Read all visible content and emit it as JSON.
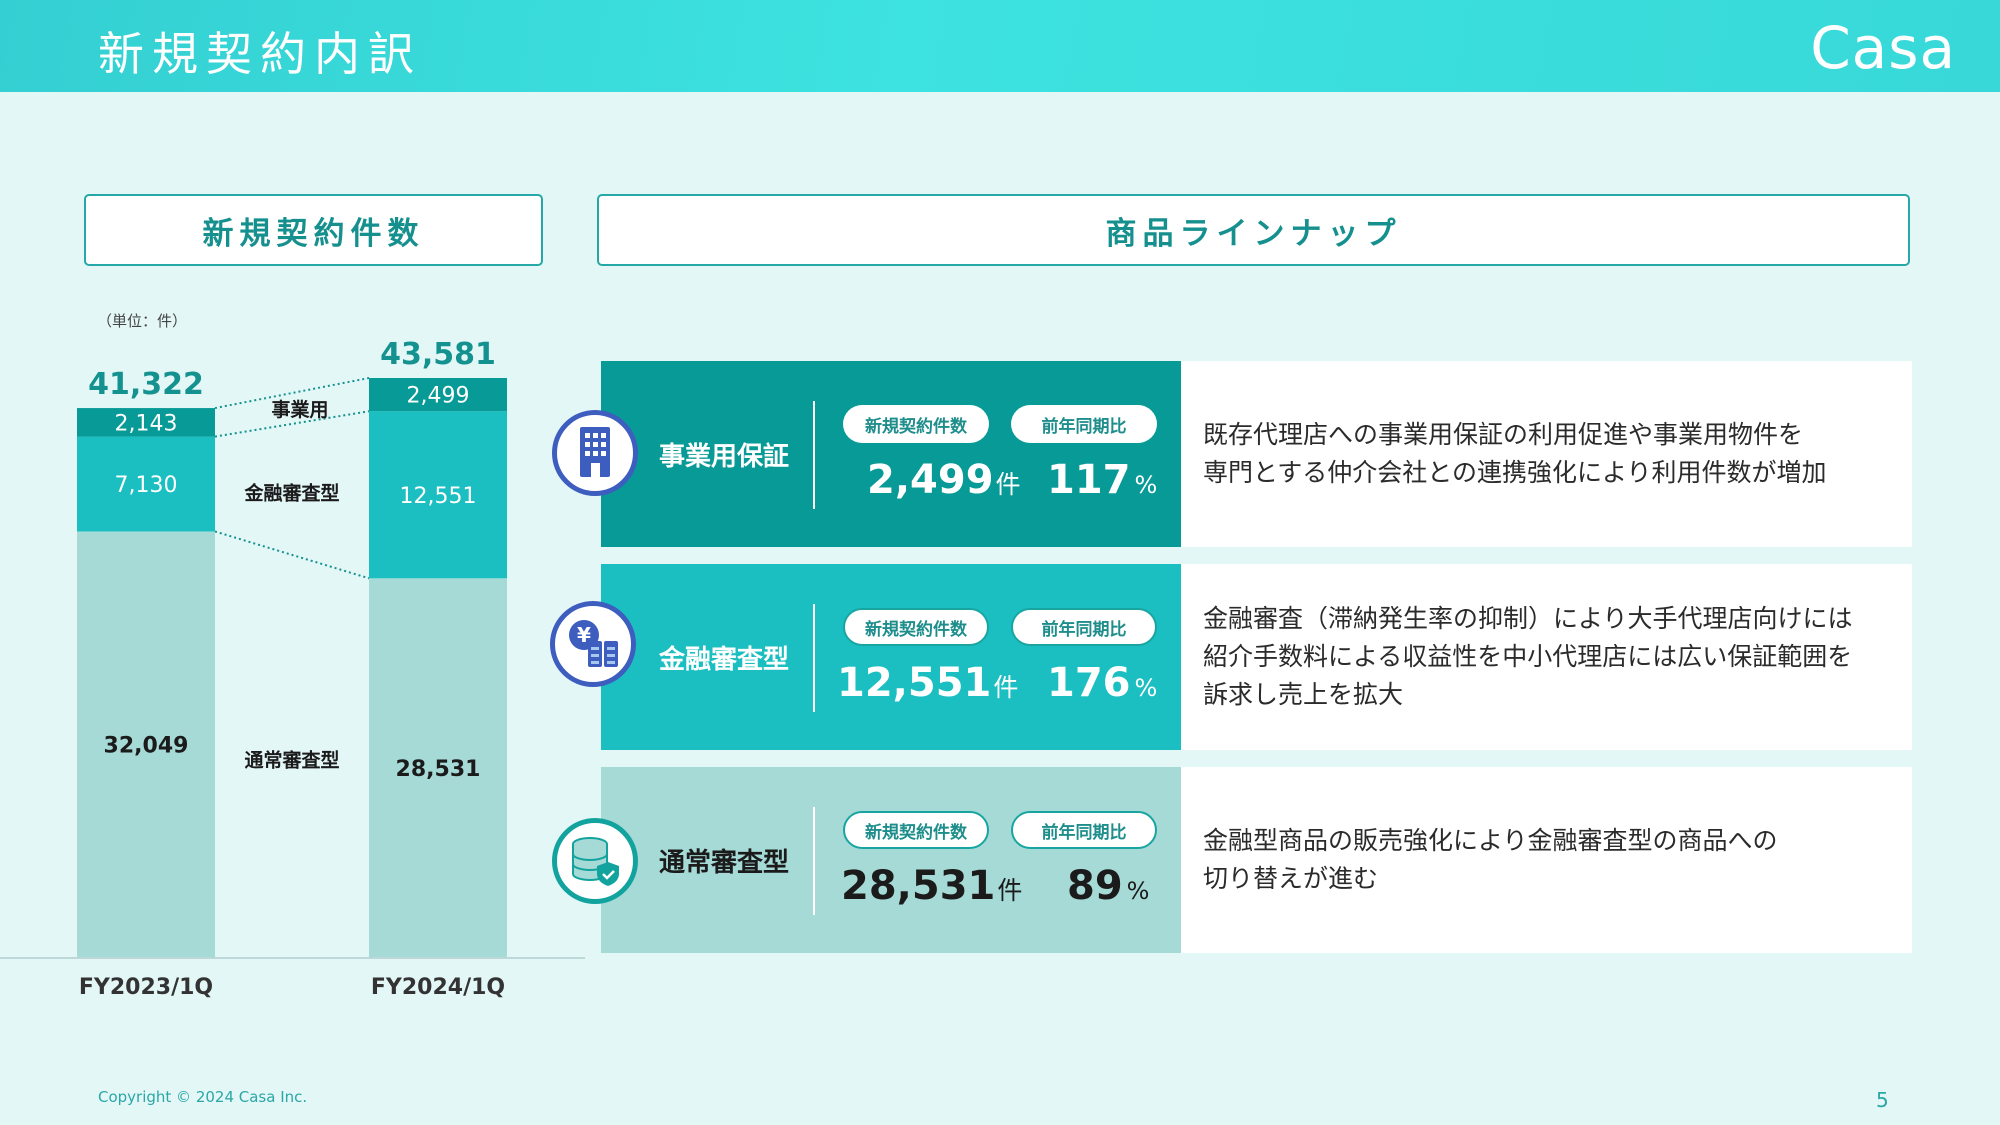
{
  "header": {
    "title": "新規契約内訳",
    "brand": "Casa"
  },
  "left_section_title": "新規契約件数",
  "right_section_title": "商品ラインナップ",
  "chart_data": {
    "type": "bar",
    "stacked": true,
    "unit_label": "（単位：件）",
    "categories": [
      "FY2023/1Q",
      "FY2024/1Q"
    ],
    "totals": [
      "41,322",
      "43,581"
    ],
    "series": [
      {
        "name": "通常審査型",
        "values": [
          32049,
          28531
        ],
        "labels": [
          "32,049",
          "28,531"
        ],
        "color": "#a6dad6",
        "label_color": "#1b1b1b"
      },
      {
        "name": "金融審査型",
        "values": [
          7130,
          12551
        ],
        "labels": [
          "7,130",
          "12,551"
        ],
        "color": "#1cbfc1",
        "label_color": "#ffffff"
      },
      {
        "name": "事業用",
        "values": [
          2143,
          2499
        ],
        "labels": [
          "2,143",
          "2,499"
        ],
        "color": "#079a96",
        "label_color": "#ffffff"
      }
    ],
    "legend": "inline-between-bars",
    "grid": false
  },
  "products": [
    {
      "name": "事業用保証",
      "icon": "building-icon",
      "metric_label_1": "新規契約件数",
      "metric_label_2": "前年同期比",
      "count": "2,499",
      "count_unit": "件",
      "yoy": "117",
      "yoy_unit": "%",
      "description": "既存代理店への事業用保証の利用促進や事業用物件を\n専門とする仲介会社との連携強化により利用件数が増加",
      "color": "#079a96"
    },
    {
      "name": "金融審査型",
      "icon": "yen-server-icon",
      "metric_label_1": "新規契約件数",
      "metric_label_2": "前年同期比",
      "count": "12,551",
      "count_unit": "件",
      "yoy": "176",
      "yoy_unit": "%",
      "description": "金融審査（滞納発生率の抑制）により大手代理店向けには\n紹介手数料による収益性を中小代理店には広い保証範囲を\n訴求し売上を拡大",
      "color": "#1cbfc1"
    },
    {
      "name": "通常審査型",
      "icon": "database-shield-icon",
      "metric_label_1": "新規契約件数",
      "metric_label_2": "前年同期比",
      "count": "28,531",
      "count_unit": "件",
      "yoy": "89",
      "yoy_unit": "%",
      "description": "金融型商品の販売強化により金融審査型の商品への\n切り替えが進む",
      "color": "#a6dad6"
    }
  ],
  "footer": {
    "copyright": "Copyright © 2024 Casa Inc.",
    "page": "5"
  }
}
